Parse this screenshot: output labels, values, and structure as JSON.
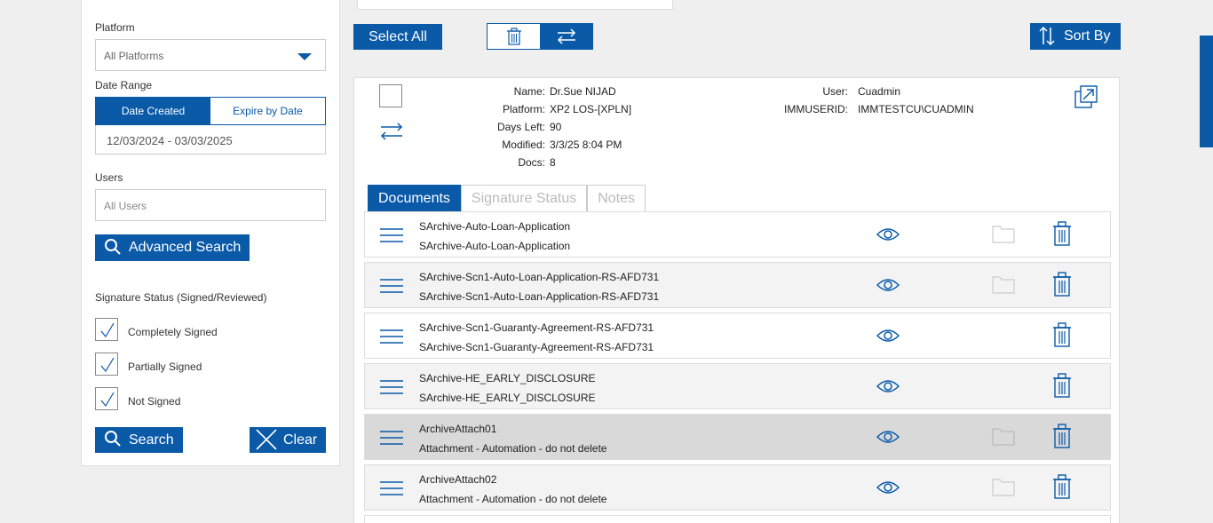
{
  "sidebar": {
    "platform_label": "Platform",
    "platform_value": "All Platforms",
    "date_range_label": "Date Range",
    "date_tabs": [
      "Date Created",
      "Expire by Date"
    ],
    "date_value": "12/03/2024 - 03/03/2025",
    "users_label": "Users",
    "users_placeholder": "All Users",
    "advanced_search_label": "Advanced Search",
    "signature_status_label": "Signature Status (Signed/Reviewed)",
    "checkboxes": [
      {
        "label": "Completely Signed",
        "checked": true
      },
      {
        "label": "Partially Signed",
        "checked": true
      },
      {
        "label": "Not Signed",
        "checked": true
      }
    ],
    "search_label": "Search",
    "clear_label": "Clear"
  },
  "toolbar": {
    "select_all_label": "Select All",
    "sort_by_label": "Sort By"
  },
  "package": {
    "keys": [
      "Name:",
      "Platform:",
      "Days Left:",
      "Modified:",
      "Docs:"
    ],
    "values": [
      "Dr.Sue NIJAD",
      "XP2 LOS-[XPLN]",
      "90",
      "3/3/25 8:04 PM",
      "8"
    ],
    "keys2": [
      "User:",
      "IMMUSERID:"
    ],
    "values2": [
      "Cuadmin",
      "IMMTESTCU\\CUADMIN"
    ]
  },
  "doc_tabs": [
    "Documents",
    "Signature Status",
    "Notes"
  ],
  "documents": [
    {
      "line1": "SArchive-Auto-Loan-Application",
      "line2": "SArchive-Auto-Loan-Application",
      "has_folder": true
    },
    {
      "line1": "SArchive-Scn1-Auto-Loan-Application-RS-AFD731",
      "line2": "SArchive-Scn1-Auto-Loan-Application-RS-AFD731",
      "has_folder": true
    },
    {
      "line1": "SArchive-Scn1-Guaranty-Agreement-RS-AFD731",
      "line2": "SArchive-Scn1-Guaranty-Agreement-RS-AFD731",
      "has_folder": false
    },
    {
      "line1": "SArchive-HE_EARLY_DISCLOSURE",
      "line2": "SArchive-HE_EARLY_DISCLOSURE",
      "has_folder": false
    },
    {
      "line1": "ArchiveAttach01",
      "line2": "Attachment - Automation - do not delete",
      "has_folder": true
    },
    {
      "line1": "ArchiveAttach02",
      "line2": "Attachment - Automation - do not delete",
      "has_folder": true
    }
  ],
  "colors": {
    "accent": "#0a5aa8",
    "background": "#efefef"
  }
}
